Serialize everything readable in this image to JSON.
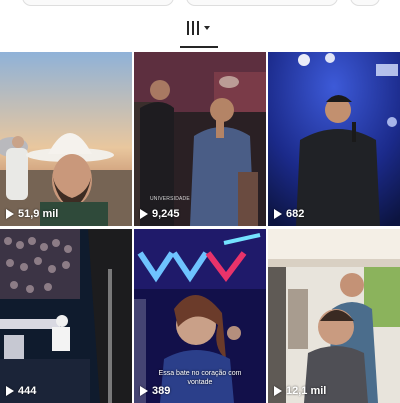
{
  "profile_tabs": {
    "active_tab_icon": "reels-grid-icon"
  },
  "reels": [
    {
      "views": "51,9 mil",
      "caption": ""
    },
    {
      "views": "9,245",
      "caption": "",
      "watermark": "UNIVERSIDADE"
    },
    {
      "views": "682",
      "caption": ""
    },
    {
      "views": "444",
      "caption": ""
    },
    {
      "views": "389",
      "caption": "Essa bate no coração com vontade"
    },
    {
      "views": "12,1 mil",
      "caption": ""
    }
  ],
  "colors": {
    "icon": "#262626",
    "overlay_text": "#ffffff"
  }
}
